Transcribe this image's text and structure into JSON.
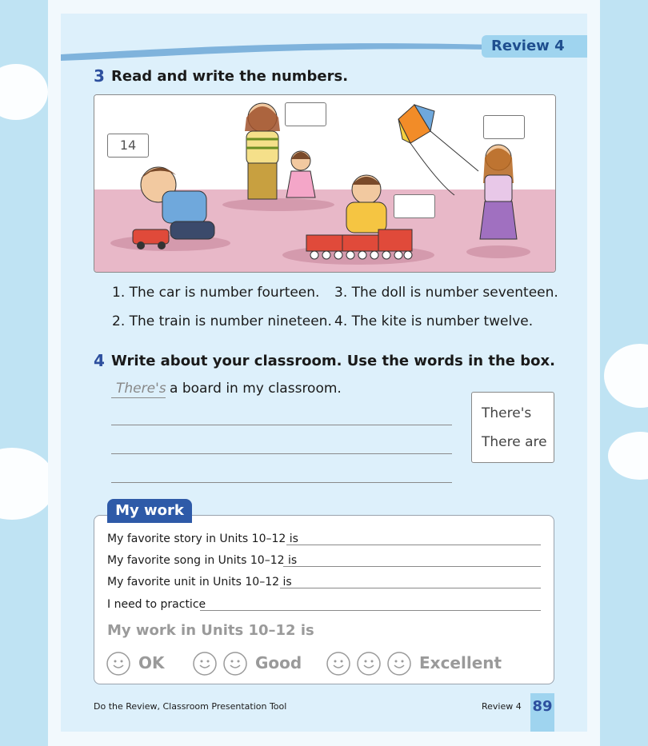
{
  "header": {
    "review_label": "Review 4"
  },
  "section3": {
    "number": "3",
    "instruction": "Read and write the numbers.",
    "example_box": "14",
    "sentences": [
      "1. The car is number fourteen.",
      "3. The doll is number seventeen.",
      "2. The train is number nineteen.",
      "4. The kite is number twelve."
    ]
  },
  "section4": {
    "number": "4",
    "instruction": "Write about your classroom. Use the words in the box.",
    "example_answer": "There's",
    "example_rest": "a board in my classroom.",
    "word_box": [
      "There's",
      "There are"
    ]
  },
  "my_work": {
    "tab_label": "My work",
    "lines": [
      "My favorite story in Units 10–12 is",
      "My favorite song in Units 10–12 is",
      "My favorite unit in Units 10–12 is",
      "I need to practice"
    ],
    "rating_title": "My work in Units 10–12 is",
    "ratings": [
      "OK",
      "Good",
      "Excellent"
    ]
  },
  "footer": {
    "left": "Do the Review, Classroom Presentation Tool",
    "right": "Review 4",
    "page_number": "89"
  },
  "colors": {
    "accent_blue": "#2e5aa8",
    "tab_blue": "#9fd4ef",
    "page_bg": "#ddf0fb",
    "floor_pink": "#e8b8c8"
  }
}
